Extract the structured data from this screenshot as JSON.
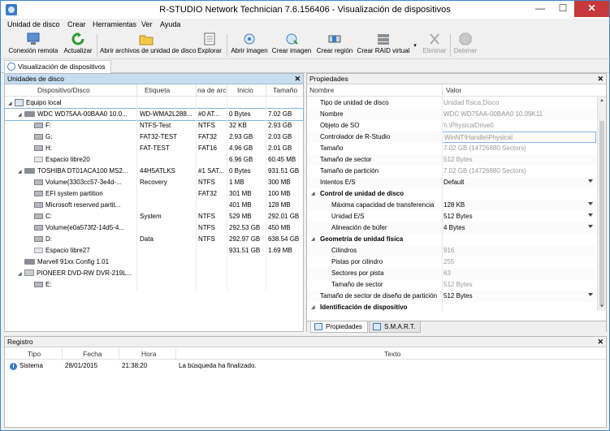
{
  "window": {
    "title": "R-STUDIO Network Technician 7.6.156406 - Visualización de dispositivos",
    "min": "—",
    "max": "☐",
    "close": "✕"
  },
  "menu": [
    "Unidad de disco",
    "Crear",
    "Herramientas",
    "Ver",
    "Ayuda"
  ],
  "toolbar": {
    "remote": "Conexión remota",
    "refresh": "Actualizar",
    "open_files": "Abrir archivos de unidad de disco",
    "explore": "Explorar",
    "open_image": "Abrir imagen",
    "create_image": "Crear imagen",
    "create_region": "Crear región",
    "create_raid": "Crear RAID virtual",
    "delete": "Eliminar",
    "stop": "Detener"
  },
  "tab": "Visualización de dispositivos",
  "left_panel": {
    "title": "Unidades de disco",
    "close": "✕",
    "columns": [
      "Dispositivo/Disco",
      "Etiqueta",
      "na de arc",
      "Inicio",
      "Tamaño"
    ],
    "rows": [
      {
        "indent": 0,
        "icon": "pc",
        "exp": "◢",
        "name": "Equipo local",
        "label": "",
        "fs": "",
        "start": "",
        "size": ""
      },
      {
        "indent": 1,
        "icon": "hdd",
        "exp": "◢",
        "name": "WDC WD75AA-00BAA0 10.0...",
        "label": "WD-WMA2L288...",
        "fs": "#0 AT...",
        "start": "0 Bytes",
        "size": "7.02 GB",
        "selected": true
      },
      {
        "indent": 2,
        "icon": "vol",
        "exp": "",
        "name": "F:",
        "label": "NTFS-Test",
        "fs": "NTFS",
        "start": "32 KB",
        "size": "2.93 GB"
      },
      {
        "indent": 2,
        "icon": "vol",
        "exp": "",
        "name": "G:",
        "label": "FAT32-TEST",
        "fs": "FAT32",
        "start": "2.93 GB",
        "size": "2.03 GB"
      },
      {
        "indent": 2,
        "icon": "vol",
        "exp": "",
        "name": "H:",
        "label": "FAT-TEST",
        "fs": "FAT16",
        "start": "4.96 GB",
        "size": "2.01 GB"
      },
      {
        "indent": 2,
        "icon": "free",
        "exp": "",
        "name": "Espacio libre20",
        "label": "",
        "fs": "",
        "start": "6.96 GB",
        "size": "60.45 MB"
      },
      {
        "indent": 1,
        "icon": "hdd",
        "exp": "◢",
        "name": "TOSHIBA DT01ACA100 MS2...",
        "label": "44H5ATLKS",
        "fs": "#1 SAT...",
        "start": "0 Bytes",
        "size": "931.51 GB"
      },
      {
        "indent": 2,
        "icon": "vol",
        "exp": "",
        "name": "Volume{3303cc57-3e4d-...",
        "label": "Recovery",
        "fs": "NTFS",
        "start": "1 MB",
        "size": "300 MB"
      },
      {
        "indent": 2,
        "icon": "vol",
        "exp": "",
        "name": "EFI system partition",
        "label": "",
        "fs": "FAT32",
        "start": "301 MB",
        "size": "100 MB"
      },
      {
        "indent": 2,
        "icon": "vol",
        "exp": "",
        "name": "Microsoft reserved partit...",
        "label": "",
        "fs": "",
        "start": "401 MB",
        "size": "128 MB"
      },
      {
        "indent": 2,
        "icon": "vol",
        "exp": "",
        "name": "C:",
        "label": "System",
        "fs": "NTFS",
        "start": "529 MB",
        "size": "292.01 GB"
      },
      {
        "indent": 2,
        "icon": "vol",
        "exp": "",
        "name": "Volume{e0a573f2-14d5-4...",
        "label": "",
        "fs": "NTFS",
        "start": "292.53 GB",
        "size": "450 MB"
      },
      {
        "indent": 2,
        "icon": "vol",
        "exp": "",
        "name": "D:",
        "label": "Data",
        "fs": "NTFS",
        "start": "292.97 GB",
        "size": "638.54 GB"
      },
      {
        "indent": 2,
        "icon": "free",
        "exp": "",
        "name": "Espacio libre27",
        "label": "",
        "fs": "",
        "start": "931.51 GB",
        "size": "1.69 MB"
      },
      {
        "indent": 1,
        "icon": "hdd",
        "exp": "",
        "name": "Marvell 91xx Config 1.01",
        "label": "",
        "fs": "",
        "start": "",
        "size": ""
      },
      {
        "indent": 1,
        "icon": "cd",
        "exp": "◢",
        "name": "PIONEER DVD-RW DVR-219L...",
        "label": "",
        "fs": "",
        "start": "",
        "size": ""
      },
      {
        "indent": 2,
        "icon": "vol",
        "exp": "",
        "name": "E:",
        "label": "",
        "fs": "",
        "start": "",
        "size": ""
      }
    ]
  },
  "right_panel": {
    "title": "Propiedades",
    "close": "✕",
    "col_name": "Nombre",
    "col_value": "Valor",
    "rows": [
      {
        "name": "Tipo de unidad de disco",
        "value": "Unidad física,Disco",
        "style": "dim",
        "indent": 1
      },
      {
        "name": "Nombre",
        "value": "WDC WD75AA-00BAA0 10.09K11",
        "style": "dim",
        "indent": 1
      },
      {
        "name": "Objeto de SO",
        "value": "\\\\.\\PhysicalDrive0",
        "style": "dim",
        "indent": 1
      },
      {
        "name": "Controlador de R-Studio",
        "value": "WinNT\\Handle\\Physical",
        "style": "dim",
        "indent": 1,
        "highlight": true
      },
      {
        "name": "Tamaño",
        "value": "7.02 GB (14726880 Sectors)",
        "style": "dim",
        "indent": 1
      },
      {
        "name": "Tamaño de sector",
        "value": "512 Bytes",
        "style": "dim",
        "indent": 1
      },
      {
        "name": "Tamaño de partición",
        "value": "7.02 GB (14726880 Sectors)",
        "style": "dim",
        "indent": 1
      },
      {
        "name": "Intentos E/S",
        "value": "Default",
        "style": "normal",
        "indent": 1,
        "dropdown": true
      },
      {
        "name": "Control de unidad de disco",
        "value": "",
        "style": "group",
        "indent": 0
      },
      {
        "name": "Máxima capacidad de transferencia",
        "value": "128 KB",
        "style": "normal",
        "indent": 2,
        "dropdown": true
      },
      {
        "name": "Unidad E/S",
        "value": "512 Bytes",
        "style": "normal",
        "indent": 2,
        "dropdown": true
      },
      {
        "name": "Alineación de búfer",
        "value": "4 Bytes",
        "style": "normal",
        "indent": 2,
        "dropdown": true
      },
      {
        "name": "Geometría de unidad física",
        "value": "",
        "style": "group",
        "indent": 0
      },
      {
        "name": "Cilindros",
        "value": "916",
        "style": "dim",
        "indent": 2
      },
      {
        "name": "Pistas por cilindro",
        "value": "255",
        "style": "dim",
        "indent": 2
      },
      {
        "name": "Sectores por pista",
        "value": "63",
        "style": "dim",
        "indent": 2
      },
      {
        "name": "Tamaño de sector",
        "value": "512 Bytes",
        "style": "dim",
        "indent": 2
      },
      {
        "name": "Tamaño de sector de diseño de partición",
        "value": "512 Bytes",
        "style": "normal",
        "indent": 1,
        "dropdown": true
      },
      {
        "name": "Identificación de dispositivo",
        "value": "",
        "style": "group",
        "indent": 0
      }
    ],
    "bottom_tabs": [
      "Propiedades",
      "S.M.A.R.T."
    ]
  },
  "log": {
    "title": "Registro",
    "close": "✕",
    "columns": [
      "Tipo",
      "Fecha",
      "Hora",
      "Texto"
    ],
    "rows": [
      {
        "type": "Sistema",
        "date": "28/01/2015",
        "time": "21:38:20",
        "text": "La búsqueda ha finalizado."
      }
    ]
  }
}
